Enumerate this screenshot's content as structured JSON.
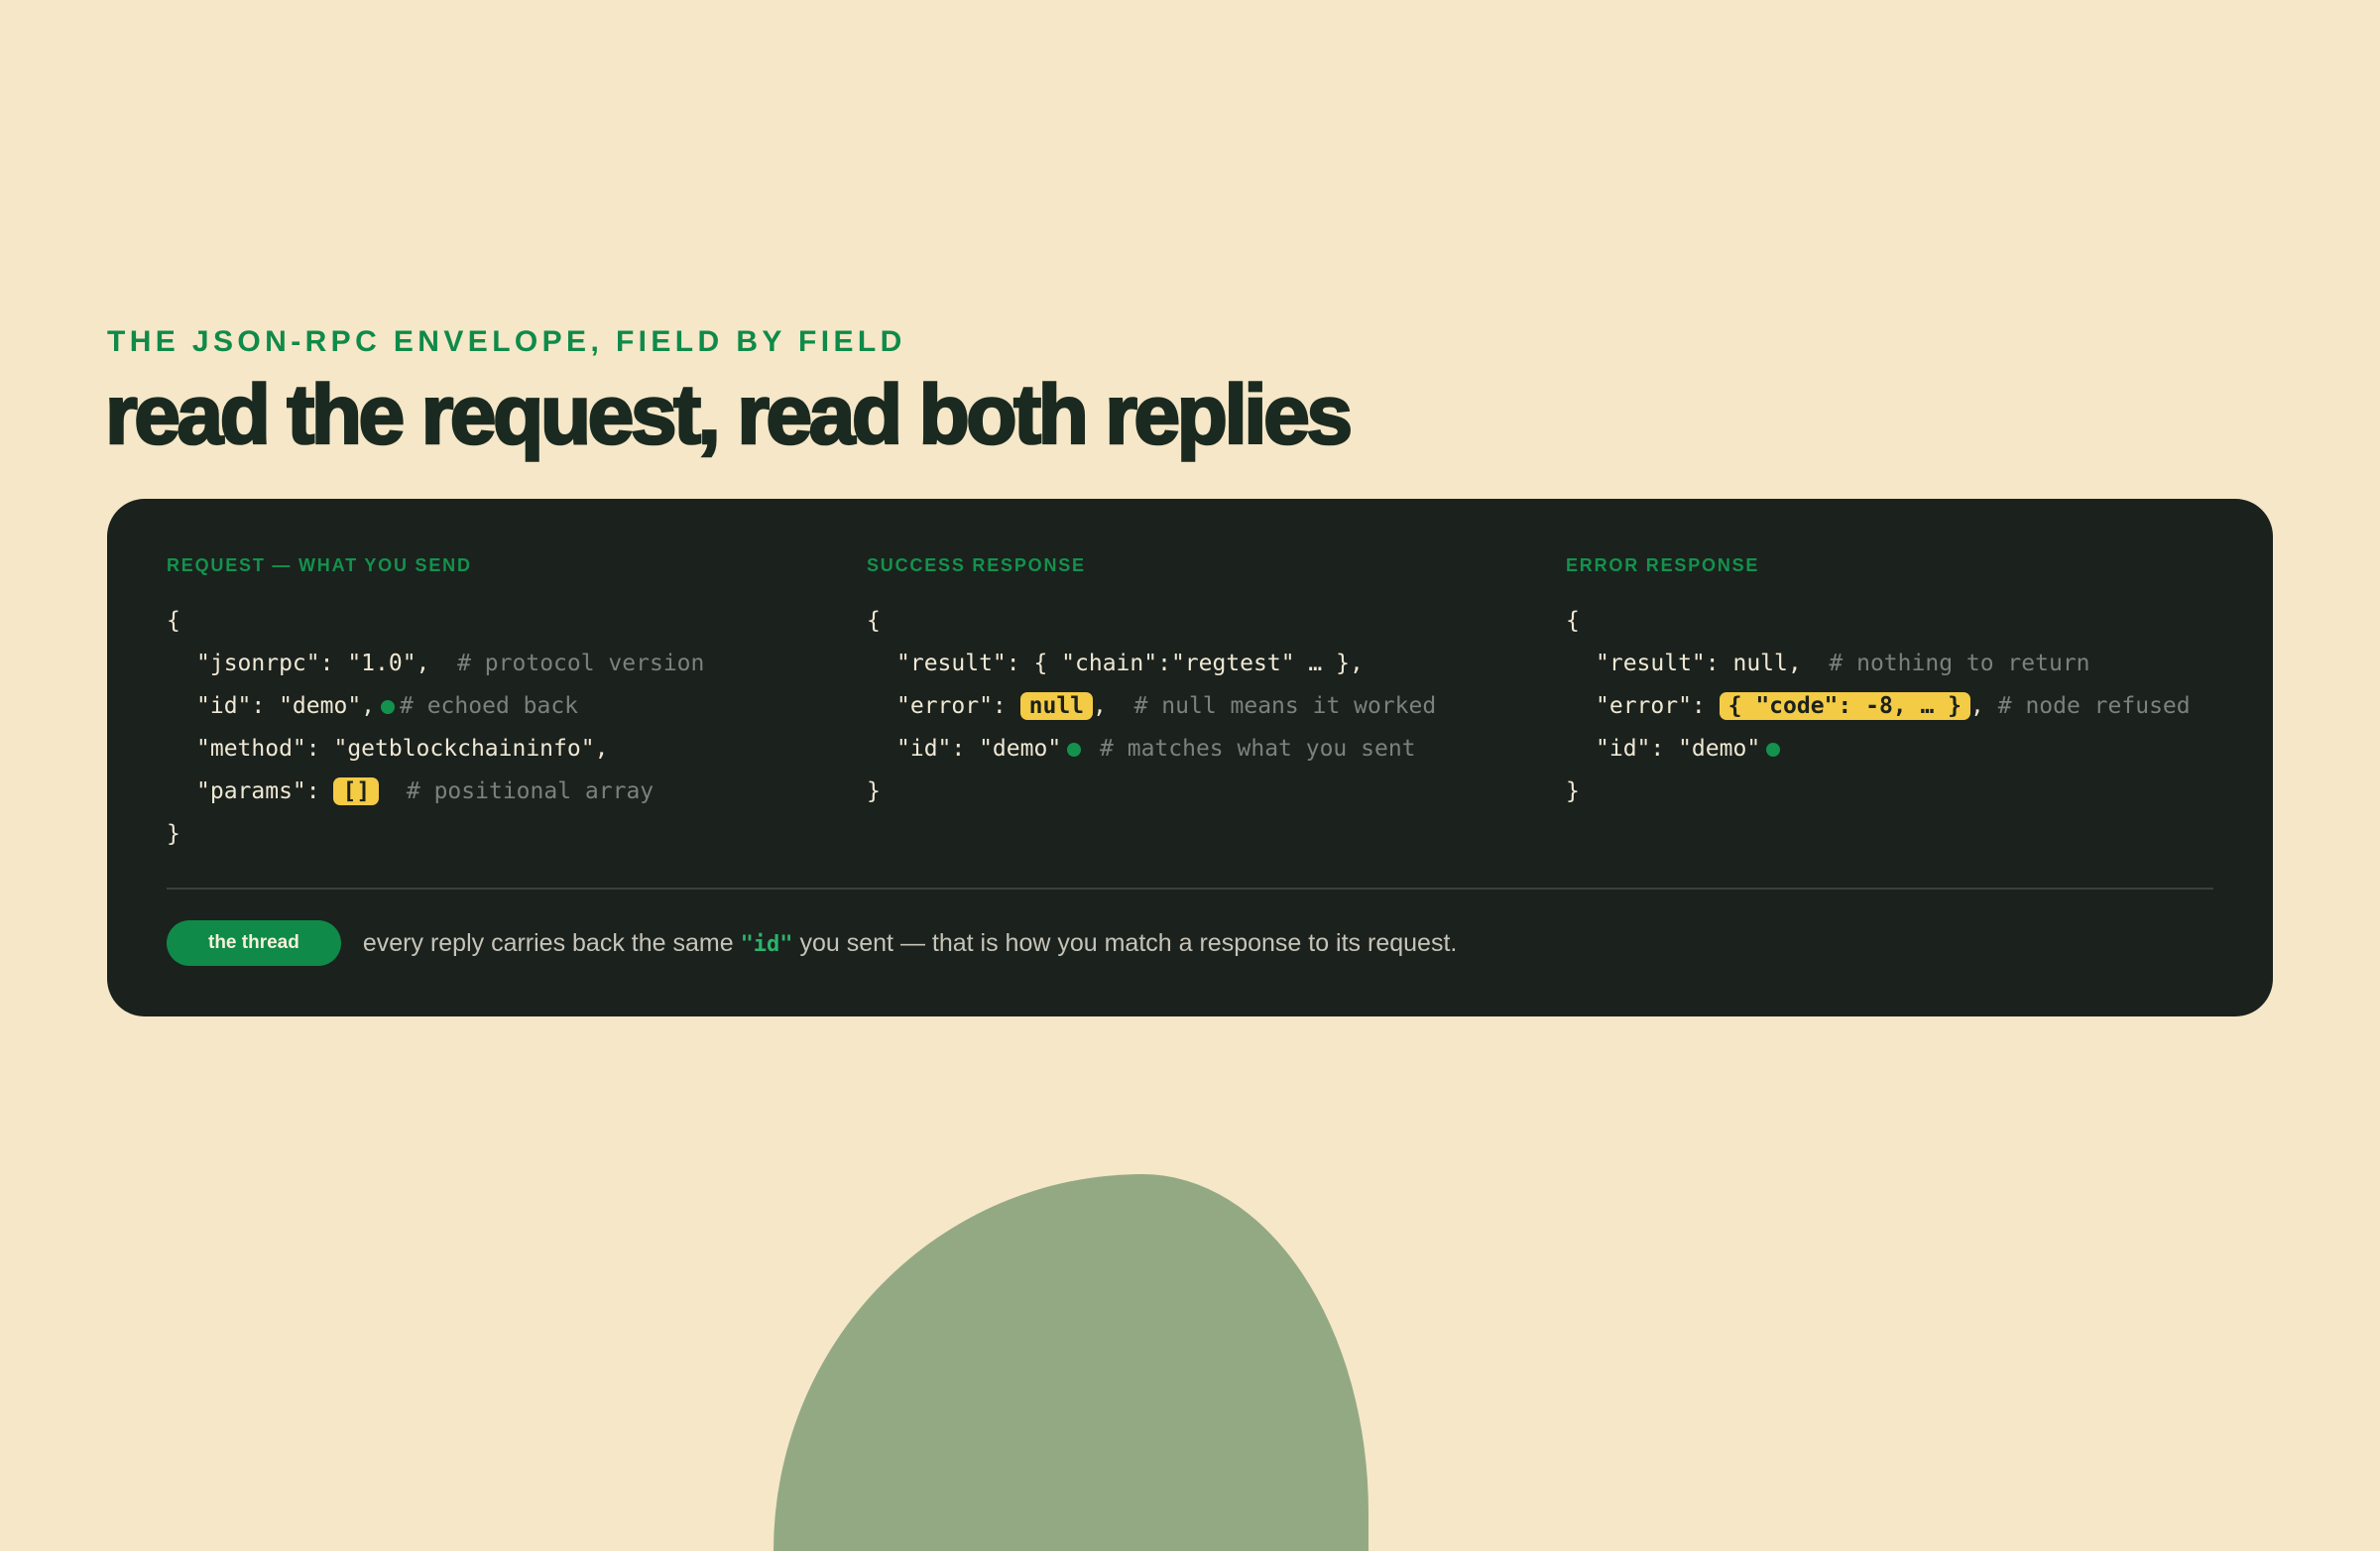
{
  "header": {
    "eyebrow": "THE JSON-RPC ENVELOPE, FIELD BY FIELD",
    "title": "read the request, read both replies"
  },
  "request": {
    "label": "REQUEST — WHAT YOU SEND",
    "open_brace": "{",
    "close_brace": "}",
    "jsonrpc_line": "\"jsonrpc\": \"1.0\",",
    "jsonrpc_comment": "# protocol version",
    "id_line": "\"id\": \"demo\",",
    "id_comment": "# echoed back",
    "method_line": "\"method\": \"getblockchaininfo\",",
    "params_key": "\"params\": ",
    "params_value": "[]",
    "params_comment": "# positional array"
  },
  "success": {
    "label": "SUCCESS RESPONSE",
    "open_brace": "{",
    "close_brace": "}",
    "result_line": "\"result\": { \"chain\":\"regtest\" … },",
    "error_key": "\"error\": ",
    "error_value": "null",
    "error_comma": ",",
    "error_comment": "# null means it worked",
    "id_line": "\"id\": \"demo\"",
    "id_comment": "# matches what you sent"
  },
  "error_response": {
    "label": "ERROR RESPONSE",
    "open_brace": "{",
    "close_brace": "}",
    "result_line": "\"result\": null,",
    "result_comment": "# nothing to return",
    "error_key": "\"error\": ",
    "error_value": "{ \"code\": -8, … }",
    "error_comma": ",",
    "error_comment": "# node refused",
    "id_line": "\"id\": \"demo\""
  },
  "footer": {
    "pill": "the thread",
    "text_before": "every reply carries back the same ",
    "code": "\"id\"",
    "text_after": " you sent — that is how you match a response to its request."
  },
  "colors": {
    "background": "#f5e7c8",
    "card": "#1b211d",
    "accent_green": "#0f8a49",
    "highlight_yellow": "#f4cb45",
    "blob": "#93a984"
  }
}
